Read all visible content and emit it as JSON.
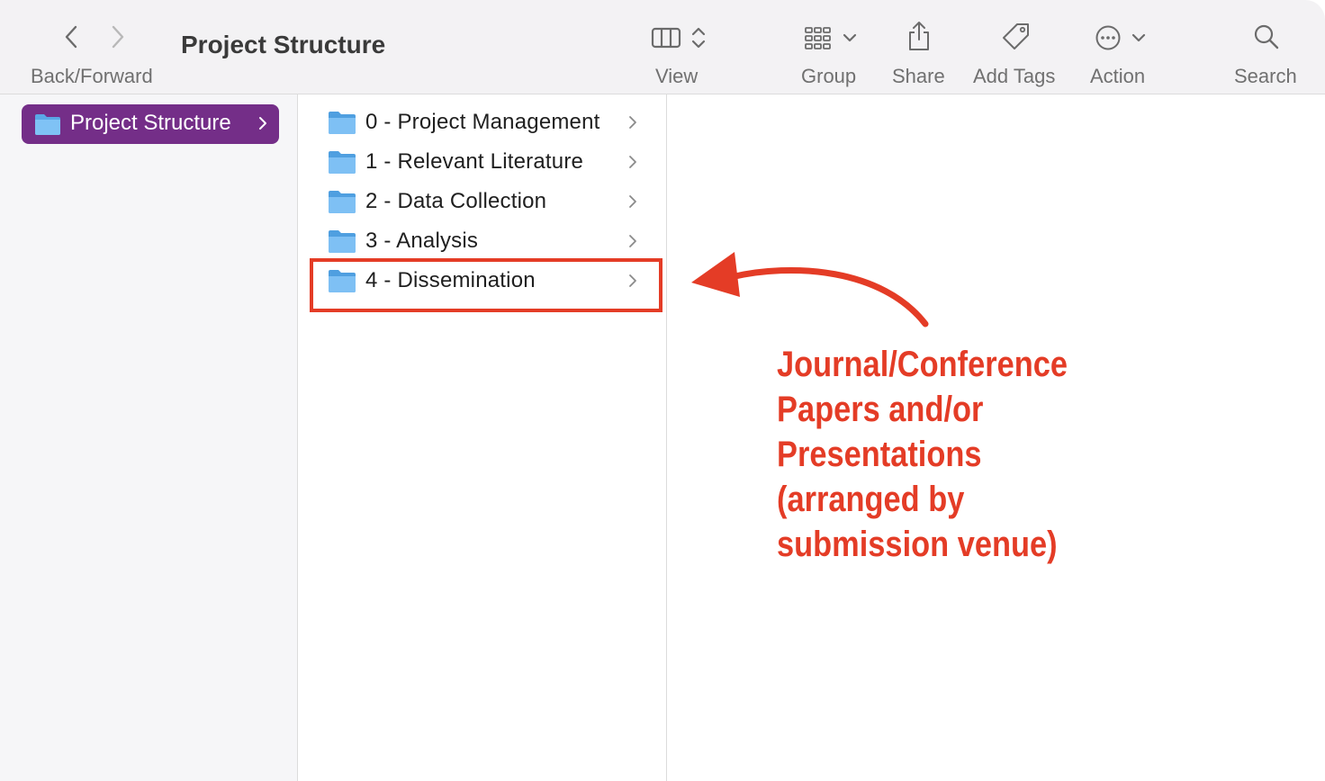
{
  "window": {
    "title": "Project Structure",
    "accent": "#742e88"
  },
  "toolbar": {
    "back_forward_label": "Back/Forward",
    "view_label": "View",
    "group_label": "Group",
    "share_label": "Share",
    "add_tags_label": "Add Tags",
    "action_label": "Action",
    "search_label": "Search",
    "icons": [
      "chevron-left-icon",
      "chevron-right-icon",
      "column-view-icon",
      "up-down-chevron-icon",
      "group-grid-icon",
      "chevron-down-icon",
      "share-icon",
      "tag-icon",
      "ellipsis-circle-icon",
      "search-icon"
    ]
  },
  "sidebar": {
    "items": [
      {
        "label": "Project Structure",
        "selected": true,
        "icon": "folder-icon"
      }
    ]
  },
  "browser": {
    "items": [
      {
        "label": "0 - Project Management",
        "icon": "folder-icon"
      },
      {
        "label": "1 - Relevant Literature",
        "icon": "folder-icon"
      },
      {
        "label": "2 - Data Collection",
        "icon": "folder-icon"
      },
      {
        "label": "3 - Analysis",
        "icon": "folder-icon"
      },
      {
        "label": "4 - Dissemination",
        "icon": "folder-icon",
        "highlighted": true
      }
    ]
  },
  "annotation": {
    "color": "#e43c26",
    "lines": [
      "Journal/Conference",
      "Papers and/or",
      "Presentations",
      "(arranged by",
      "submission venue)"
    ]
  }
}
